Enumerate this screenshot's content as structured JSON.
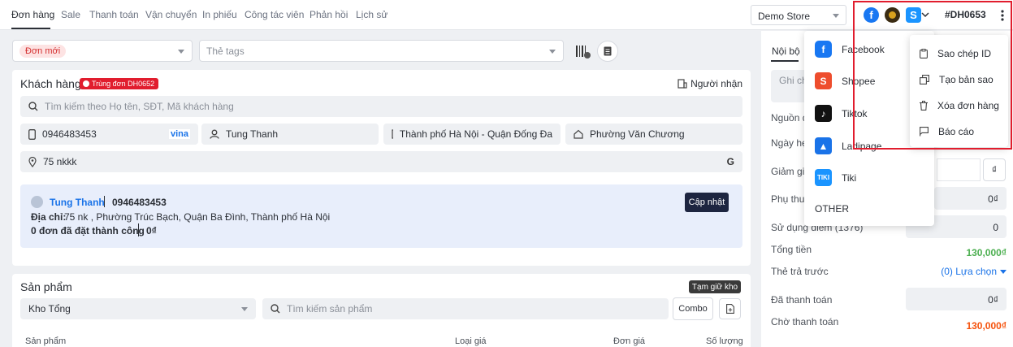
{
  "nav": {
    "tabs": [
      "Đơn hàng",
      "Sale",
      "Thanh toán",
      "Vận chuyển",
      "In phiếu",
      "Công tác viên",
      "Phản hồi",
      "Lịch sử"
    ],
    "store": "Demo Store",
    "order_id": "#DH0653"
  },
  "status": {
    "label": "Đơn mới",
    "tags_placeholder": "Thẻ tags"
  },
  "customer": {
    "title": "Khách hàng",
    "duplicate_badge": "Trùng đơn DH0652",
    "receiver_link": "Người nhận",
    "search_placeholder": "Tìm kiếm theo Họ tên, SĐT, Mã khách hàng",
    "phone": "0946483453",
    "carrier": "vina",
    "name": "Tung Thanh",
    "province": "Thành phố Hà Nội - Quận Đống Đa",
    "ward": "Phường Văn Chương",
    "address": "75 nkkk",
    "info": {
      "name": "Tung Thanh",
      "phone": "0946483453",
      "address_label": "Địa chỉ:",
      "address": "75 nk , Phường Trúc Bạch, Quận Ba Đình, Thành phố Hà Nội",
      "orders_text": "0 đơn đã đặt thành công",
      "amount": "0₫",
      "update_btn": "Cập nhật"
    }
  },
  "products": {
    "title": "Sản phẩm",
    "hold_badge": "Tạm giữ kho",
    "warehouse": "Kho Tổng",
    "search_placeholder": "Tìm kiếm sản phẩm",
    "combo": "Combo",
    "columns": [
      "Sản phẩm",
      "Loại giá",
      "Đơn giá",
      "Số lượng"
    ]
  },
  "right_panel": {
    "tab": "Nội bộ",
    "note_placeholder": "Ghi ch",
    "rows": {
      "source": "Nguồn đ",
      "date": "Ngày hẹ",
      "discount": "Giảm giá",
      "discount_unit": "₫",
      "surcharge": "Phụ thu",
      "surcharge_val": "0₫",
      "points": "Sử dụng điểm (1376)",
      "points_val": "0",
      "total": "Tổng tiền",
      "total_val": "130,000₫",
      "prepaid": "Thẻ trả trước",
      "prepaid_val": "(0) Lựa chọn",
      "paid": "Đã thanh toán",
      "paid_val": "0₫",
      "pending": "Chờ thanh toán",
      "pending_val": "130,000₫"
    }
  },
  "source_menu": {
    "items": [
      {
        "label": "Facebook",
        "icon": "facebook-icon",
        "color": "#1877f2"
      },
      {
        "label": "Shopee",
        "icon": "shopee-icon",
        "color": "#ee4d2d"
      },
      {
        "label": "Tiktok",
        "icon": "tiktok-icon",
        "color": "#111111"
      },
      {
        "label": "Ladipage",
        "icon": "ladipage-icon",
        "color": "#1a73e8"
      },
      {
        "label": "Tiki",
        "icon": "tiki-icon",
        "color": "#1a94ff"
      }
    ],
    "other": "OTHER"
  },
  "actions_menu": {
    "items": [
      {
        "label": "Sao chép ID",
        "icon": "clipboard-icon"
      },
      {
        "label": "Tạo bản sao",
        "icon": "copy-icon"
      },
      {
        "label": "Xóa đơn hàng",
        "icon": "trash-icon"
      },
      {
        "label": "Báo cáo",
        "icon": "flag-icon"
      }
    ]
  },
  "colors": {
    "accent_red": "#e11d2e",
    "green": "#4caf50",
    "orange": "#f5520c",
    "blue": "#1a73e8",
    "dark": "#1d2540"
  }
}
